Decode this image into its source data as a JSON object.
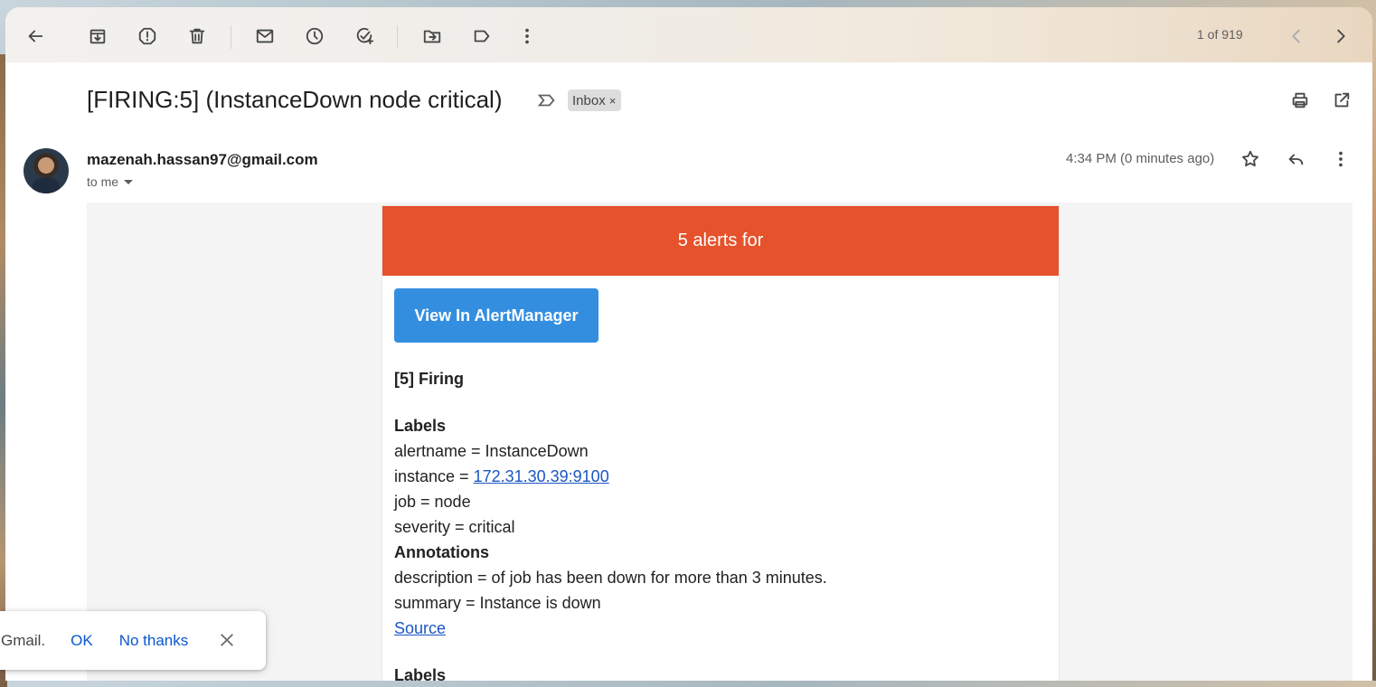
{
  "toolbar": {
    "icons": [
      "back-arrow-icon",
      "archive-icon",
      "report-spam-icon",
      "delete-icon",
      "mark-unread-icon",
      "snooze-icon",
      "add-to-tasks-icon",
      "move-to-icon",
      "label-icon",
      "more-vert-icon"
    ],
    "page_count": "1 of 919",
    "nav": [
      "chevron-left-icon",
      "chevron-right-icon"
    ]
  },
  "email": {
    "subject": "[FIRING:5] (InstanceDown node critical)",
    "label": "Inbox",
    "label_remove": "×",
    "sender": "mazenah.hassan97@gmail.com",
    "recipient": "to me",
    "timestamp": "4:34 PM (0 minutes ago)"
  },
  "message": {
    "header": "5 alerts for",
    "button": "View In AlertManager",
    "firing": "[5] Firing",
    "labels_heading": "Labels",
    "alertname": "alertname = InstanceDown",
    "instance_prefix": "instance = ",
    "instance_link": "172.31.30.39:9100",
    "job": "job = node",
    "severity": "severity = critical",
    "annotations_heading": "Annotations",
    "description": "description = of job has been down for more than 3 minutes.",
    "summary": "summary = Instance is down",
    "source_link": "Source",
    "labels_heading_2": "Labels"
  },
  "toast": {
    "message": "Gmail.",
    "ok": "OK",
    "no_thanks": "No thanks"
  },
  "colors": {
    "alert_header": "#e6522c",
    "button": "#348ee0",
    "link": "#1a56c4",
    "toast_action": "#0b57d0"
  }
}
